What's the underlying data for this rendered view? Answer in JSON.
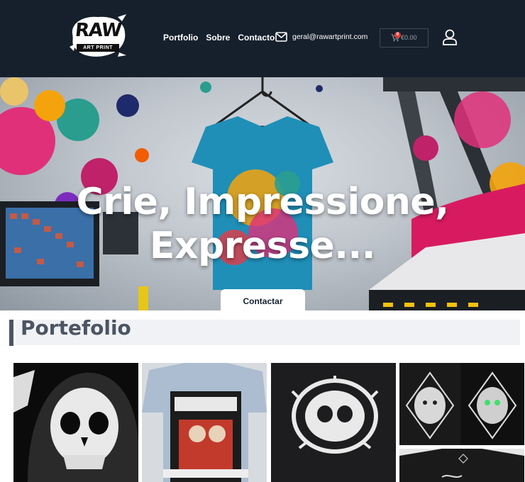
{
  "brand": {
    "logo_name": "RAW",
    "logo_tagline": "ART PRINT"
  },
  "nav": {
    "items": [
      "Portfolio",
      "Sobre",
      "Contacto"
    ],
    "email": "geral@rawartprint.com"
  },
  "cart": {
    "count": "0",
    "total": "€0.00"
  },
  "hero": {
    "title_line1": "Crie, Impressione,",
    "title_line2": "Expresse...",
    "cta_label": "Contactar"
  },
  "portfolio": {
    "heading": "Portefolio",
    "items": [
      {
        "label": "",
        "bg": "#0b0b0b"
      },
      {
        "label": "",
        "bg": "#d7dbe0"
      },
      {
        "label": "",
        "bg": "#1d1d1f"
      },
      {
        "label": "",
        "bg": "#111111"
      },
      {
        "label": "",
        "bg": "#1a1a1a"
      }
    ]
  },
  "colors": {
    "header_bg": "#16202c",
    "accent_badge": "#e03b3b",
    "heading_text": "#4b5563"
  }
}
